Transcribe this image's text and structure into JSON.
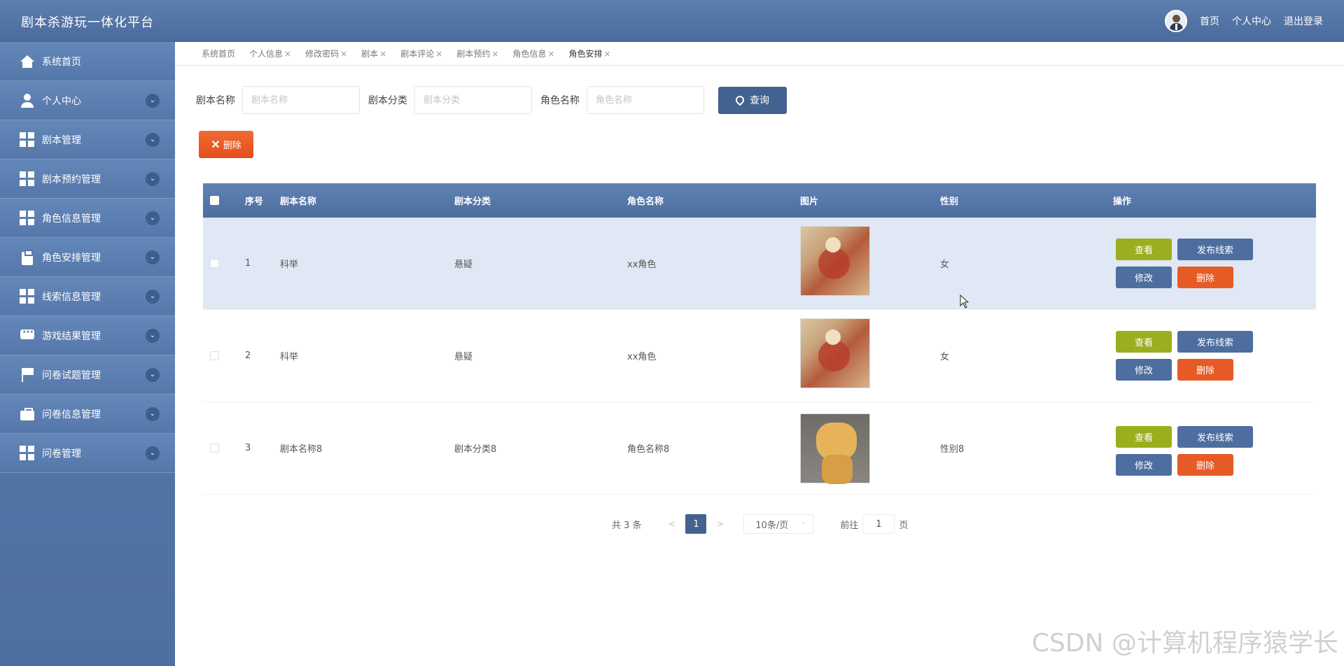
{
  "app": {
    "title": "剧本杀游玩一体化平台"
  },
  "header": {
    "links": [
      "首页",
      "个人中心",
      "退出登录"
    ]
  },
  "sidebar": {
    "items": [
      {
        "label": "系统首页",
        "icon": "home-icon"
      },
      {
        "label": "个人中心",
        "icon": "user-icon"
      },
      {
        "label": "剧本管理",
        "icon": "grid-icon"
      },
      {
        "label": "剧本预约管理",
        "icon": "grid-icon"
      },
      {
        "label": "角色信息管理",
        "icon": "grid-icon"
      },
      {
        "label": "角色安排管理",
        "icon": "clipboard-icon"
      },
      {
        "label": "线索信息管理",
        "icon": "grid-icon"
      },
      {
        "label": "游戏结果管理",
        "icon": "chat-icon"
      },
      {
        "label": "问卷试题管理",
        "icon": "flag-icon"
      },
      {
        "label": "问卷信息管理",
        "icon": "briefcase-icon"
      },
      {
        "label": "问卷管理",
        "icon": "grid-icon"
      }
    ]
  },
  "tabs": [
    {
      "label": "系统首页",
      "closable": false
    },
    {
      "label": "个人信息",
      "closable": true
    },
    {
      "label": "修改密码",
      "closable": true
    },
    {
      "label": "剧本",
      "closable": true
    },
    {
      "label": "剧本评论",
      "closable": true
    },
    {
      "label": "剧本预约",
      "closable": true
    },
    {
      "label": "角色信息",
      "closable": true
    },
    {
      "label": "角色安排",
      "closable": true,
      "active": true
    }
  ],
  "search": {
    "f1_label": "剧本名称",
    "f1_placeholder": "剧本名称",
    "f2_label": "剧本分类",
    "f2_placeholder": "剧本分类",
    "f3_label": "角色名称",
    "f3_placeholder": "角色名称",
    "query_label": "查询"
  },
  "toolbar": {
    "delete_label": "删除"
  },
  "table": {
    "headers": [
      "序号",
      "剧本名称",
      "剧本分类",
      "角色名称",
      "图片",
      "性别",
      "操作"
    ],
    "rows": [
      {
        "no": "1",
        "name": "科举",
        "category": "悬疑",
        "role": "xx角色",
        "gender": "女"
      },
      {
        "no": "2",
        "name": "科举",
        "category": "悬疑",
        "role": "xx角色",
        "gender": "女"
      },
      {
        "no": "3",
        "name": "剧本名称8",
        "category": "剧本分类8",
        "role": "角色名称8",
        "gender": "性别8"
      }
    ],
    "actions": {
      "view": "查看",
      "clue": "发布线索",
      "edit": "修改",
      "delete": "删除"
    }
  },
  "pager": {
    "total": "共 3 条",
    "current": "1",
    "size": "10条/页",
    "goto": "前往",
    "goto_value": "1",
    "page_unit": "页"
  },
  "watermark": "CSDN @计算机程序猿学长"
}
